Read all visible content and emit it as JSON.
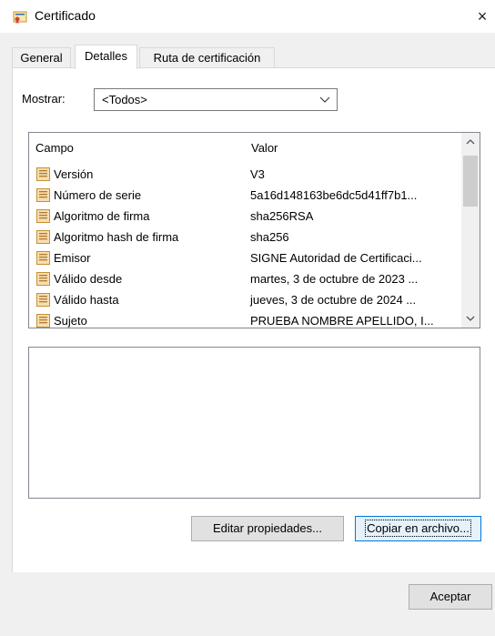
{
  "window": {
    "title": "Certificado",
    "close_symbol": "×"
  },
  "tabs": [
    {
      "label": "General",
      "active": false
    },
    {
      "label": "Detalles",
      "active": true
    },
    {
      "label": "Ruta de certificación",
      "active": false
    }
  ],
  "show": {
    "label": "Mostrar:",
    "value": "<Todos>"
  },
  "list": {
    "columns": {
      "field": "Campo",
      "value": "Valor"
    },
    "rows": [
      {
        "field": "Versión",
        "value": "V3"
      },
      {
        "field": "Número de serie",
        "value": "5a16d148163be6dc5d41ff7b1..."
      },
      {
        "field": "Algoritmo de firma",
        "value": "sha256RSA"
      },
      {
        "field": "Algoritmo hash de firma",
        "value": "sha256"
      },
      {
        "field": "Emisor",
        "value": "SIGNE Autoridad de Certificaci..."
      },
      {
        "field": "Válido desde",
        "value": "martes, 3 de octubre de 2023 ..."
      },
      {
        "field": "Válido hasta",
        "value": "jueves, 3 de octubre de 2024 ..."
      },
      {
        "field": "Sujeto",
        "value": "PRUEBA NOMBRE APELLIDO, I..."
      }
    ]
  },
  "buttons": {
    "edit_properties": "Editar propiedades...",
    "copy_to_file": "Copiar en archivo...",
    "accept": "Aceptar"
  },
  "colors": {
    "dialog_bg": "#f0f0f0",
    "focus_border": "#0078d7",
    "icon_fill": "#f5deb3",
    "icon_stroke": "#c8902e"
  }
}
